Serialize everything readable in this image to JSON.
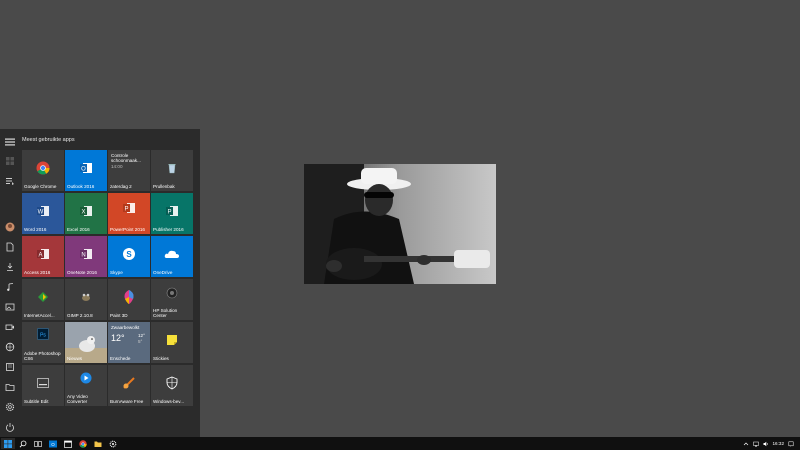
{
  "start_menu": {
    "group_title": "Meest gebruikte apps",
    "tiles": {
      "chrome": "Google Chrome",
      "outlook": "Outlook 2016",
      "controle_line1": "Controle",
      "controle_line2": "schoonmaak...",
      "controle_time": "14:00",
      "controle_day": "zaterdag 2",
      "prullenbak": "Prullenbak",
      "word": "Word 2016",
      "excel": "Excel 2016",
      "powerpoint": "PowerPoint 2016",
      "publisher": "Publisher 2016",
      "access": "Access 2016",
      "onenote": "OneNote 2016",
      "skype": "Skype",
      "onedrive": "OneDrive",
      "internetaccel": "InternetAccel...",
      "gimp": "GIMP 2.10.8",
      "paint3d": "Paint 3D",
      "hp_solution": "HP Solution Center",
      "photoshop": "Adobe Photoshop CS6",
      "nieuws": "Nieuws",
      "weather_condition": "Zwaarbewolkt",
      "weather_temp": "12°",
      "weather_hi": "12°",
      "weather_lo": "5°",
      "weather_city": "Enschede",
      "stickies": "Stickies",
      "subtitle_edit": "Subtitle Edit",
      "any_video": "Any Video Converter",
      "burnaware": "BurnAware Free",
      "windows_beveiliging": "Windows-bev..."
    }
  },
  "taskbar": {
    "clock": "16:32"
  },
  "colors": {
    "desktop": "#4a4a4a",
    "start_bg": "#2b2b2b",
    "tile_gray": "#3d3d3d",
    "tile_blue": "#0078d7",
    "word": "#2b579a",
    "excel": "#217346",
    "powerpoint": "#d24726",
    "publisher": "#077568",
    "access": "#a4373a",
    "onenote": "#80397b"
  },
  "icons": [
    "hamburger-icon",
    "user-avatar",
    "document-icon",
    "download-icon",
    "music-icon",
    "picture-icon",
    "video-icon",
    "network-icon",
    "explorer-icon",
    "folder-icon",
    "settings-icon",
    "power-icon"
  ]
}
